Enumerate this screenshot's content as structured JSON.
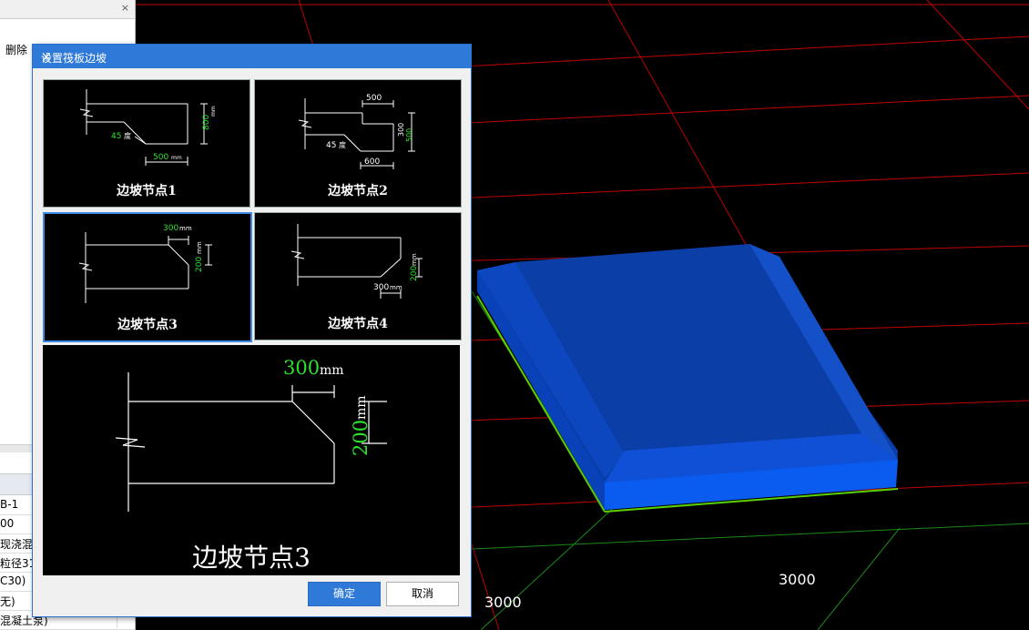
{
  "left_panel": {
    "close_glyph": "×",
    "toolbar_delete": "删除",
    "rows": [
      "B-1",
      "00",
      "现浇混凝",
      "粒径31",
      "C30)",
      "无)",
      "混凝土泵)"
    ]
  },
  "dialog": {
    "title": "设置筏板边坡",
    "close_glyph": "×",
    "nodes": [
      {
        "label": "边坡节点1",
        "dims": [
          "500",
          "800",
          "45",
          "度",
          "mm",
          "mm"
        ]
      },
      {
        "label": "边坡节点2",
        "dims": [
          "500",
          "300",
          "500",
          "600",
          "45",
          "度"
        ]
      },
      {
        "label": "边坡节点3",
        "dims": [
          "300",
          "200",
          "mm",
          "mm"
        ]
      },
      {
        "label": "边坡节点4",
        "dims": [
          "300",
          "200",
          "mm",
          "mm"
        ]
      }
    ],
    "selected_index": 2,
    "preview": {
      "label": "边坡节点3",
      "dim_top": "300",
      "dim_side": "200",
      "unit": "mm"
    },
    "ok_label": "确定",
    "cancel_label": "取消"
  },
  "viewport": {
    "dim_label_left": "3000",
    "dim_label_right": "3000",
    "slab_color": "#0a3ca8",
    "grid_color": "#c00000",
    "axis_color": "#1a8a1a"
  }
}
